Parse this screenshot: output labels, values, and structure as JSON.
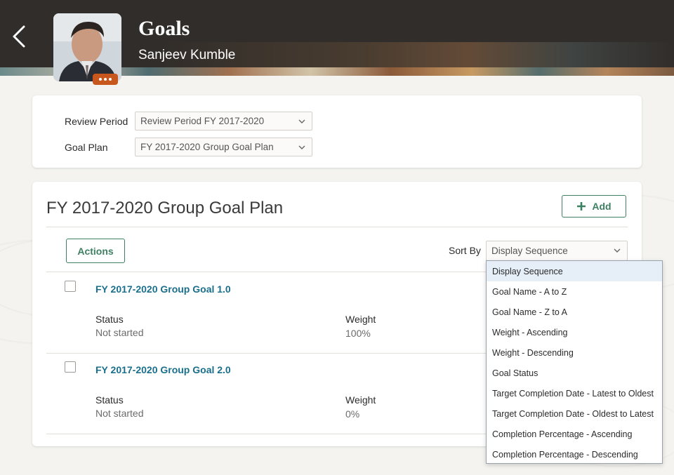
{
  "header": {
    "title": "Goals",
    "subtitle": "Sanjeev Kumble",
    "back_icon": "chevron-left-icon",
    "avatar_more_icon": "more-horizontal-icon"
  },
  "filters": {
    "review_period_label": "Review Period",
    "review_period_value": "Review Period FY 2017-2020",
    "goal_plan_label": "Goal Plan",
    "goal_plan_value": "FY 2017-2020 Group Goal Plan"
  },
  "plan": {
    "title": "FY 2017-2020 Group Goal Plan",
    "add_label": "Add",
    "actions_label": "Actions",
    "sort_by_label": "Sort By",
    "sort_by_value": "Display Sequence"
  },
  "goals": [
    {
      "name": "FY 2017-2020 Group Goal 1.0",
      "status_label": "Status",
      "status_value": "Not started",
      "weight_label": "Weight",
      "weight_value": "100%"
    },
    {
      "name": "FY 2017-2020 Group Goal 2.0",
      "status_label": "Status",
      "status_value": "Not started",
      "weight_label": "Weight",
      "weight_value": "0%"
    }
  ],
  "sort_options": [
    "Display Sequence",
    "Goal Name - A to Z",
    "Goal Name - Z to A",
    "Weight - Ascending",
    "Weight - Descending",
    "Goal Status",
    "Target Completion Date - Latest to Oldest",
    "Target Completion Date - Oldest to Latest",
    "Completion Percentage - Ascending",
    "Completion Percentage - Descending"
  ],
  "colors": {
    "header_bg": "#312d2a",
    "accent_green": "#3f7f62",
    "link_blue": "#1a6f8c",
    "avatar_badge": "#c8571e"
  }
}
